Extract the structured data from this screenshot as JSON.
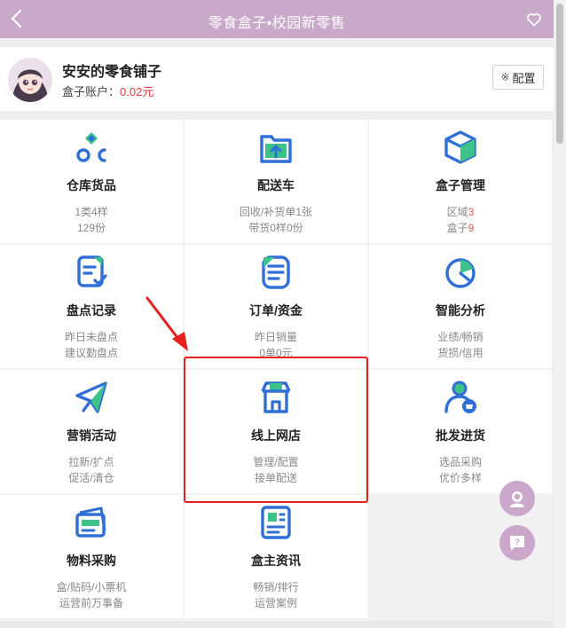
{
  "header": {
    "title": "零食盒子•校园新零售"
  },
  "store": {
    "name": "安安的零食铺子",
    "balance_label": "盒子账户：",
    "balance_value": "0.02元",
    "config_glyph": "※",
    "config_label": "配置"
  },
  "grid": [
    {
      "icon": "warehouse-goods-icon",
      "label": "仓库货品",
      "sub1": "1类4样",
      "sub2": "129份",
      "sub1_red": true,
      "sub2_red": true
    },
    {
      "icon": "delivery-cart-icon",
      "label": "配送车",
      "sub1": "回收/补货单1张",
      "sub2": "带货0样0份",
      "sub1_red": false,
      "sub2_red": false
    },
    {
      "icon": "box-manage-icon",
      "label": "盒子管理",
      "sub1a": "区域",
      "sub1b": "3",
      "sub2a": "盒子",
      "sub2b": "9"
    },
    {
      "icon": "inventory-record-icon",
      "label": "盘点记录",
      "sub1": "昨日未盘点",
      "sub2": "建议勤盘点",
      "sub1_red": false,
      "sub2_red": false
    },
    {
      "icon": "order-funds-icon",
      "label": "订单/资金",
      "sub1": "昨日销量",
      "sub2": "0单0元",
      "sub1_red": false,
      "sub2_red": true
    },
    {
      "icon": "smart-analysis-icon",
      "label": "智能分析",
      "sub1": "业绩/畅销",
      "sub2": "货损/信用",
      "sub1_red": false,
      "sub2_red": false
    },
    {
      "icon": "marketing-icon",
      "label": "营销活动",
      "sub1": "拉新/扩点",
      "sub2": "促活/清仓",
      "sub1_red": false,
      "sub2_red": false
    },
    {
      "icon": "online-store-icon",
      "label": "线上网店",
      "sub1": "管理/配置",
      "sub2": "接单配送",
      "sub1_red": false,
      "sub2_red": false
    },
    {
      "icon": "wholesale-icon",
      "label": "批发进货",
      "sub1": "选品采购",
      "sub2": "优价多样",
      "sub1_red": false,
      "sub2_red": false
    },
    {
      "icon": "material-purchase-icon",
      "label": "物料采购",
      "sub1": "盒/贴码/小票机",
      "sub2": "运营前万事备",
      "sub1_red": false,
      "sub2_red": false
    },
    {
      "icon": "owner-news-icon",
      "label": "盒主资讯",
      "sub1": "畅销/排行",
      "sub2": "运营案例",
      "sub1_red": false,
      "sub2_red": false
    }
  ],
  "colors": {
    "header": "#c9a9c9",
    "icon_blue": "#2f6fd6",
    "icon_green": "#3cc38a",
    "accent_red": "#e05a5a",
    "highlight": "#e8201d"
  }
}
